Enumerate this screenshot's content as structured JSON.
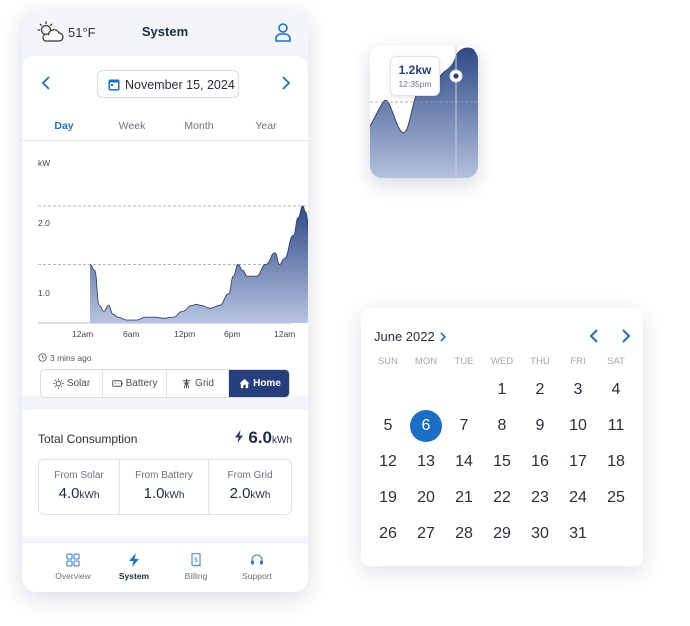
{
  "colors": {
    "accent": "#1a73c8",
    "navy": "#263f7c",
    "chart_fill_top": "#2e4a87",
    "chart_fill_bottom": "#b8c4e0",
    "selected_day": "#1a6fc4"
  },
  "header": {
    "weather_icon": "partly-cloudy-icon",
    "temperature": "51°F",
    "title": "System",
    "profile_icon": "user-icon"
  },
  "date_nav": {
    "date": "November 15, 2024"
  },
  "period_tabs": [
    {
      "label": "Day",
      "active": true
    },
    {
      "label": "Week",
      "active": false
    },
    {
      "label": "Month",
      "active": false
    },
    {
      "label": "Year",
      "active": false
    }
  ],
  "chart_data": {
    "type": "area",
    "ylabel": "kW",
    "y_ticks": [
      "2.0",
      "1.0"
    ],
    "x_ticks": [
      "12am",
      "6am",
      "12pm",
      "6pm",
      "12am"
    ],
    "ylim": [
      0,
      2.0
    ],
    "reference_lines": [
      1.0,
      2.0
    ],
    "series": [
      {
        "x_hours": [
          0,
          0.5,
          1,
          1.5,
          2,
          2.5,
          3,
          4,
          5,
          6,
          7,
          8,
          9,
          10,
          11,
          11.5,
          12,
          13,
          14,
          15,
          15.5,
          16,
          16.5,
          17,
          18,
          19,
          20,
          20.5,
          21,
          22,
          22.5,
          23,
          23.3,
          24
        ],
        "values": [
          1.0,
          0.9,
          0.3,
          0.2,
          0.3,
          0.15,
          0.1,
          0.05,
          0.05,
          0.1,
          0.1,
          0.08,
          0.1,
          0.2,
          0.3,
          0.32,
          0.3,
          0.25,
          0.3,
          0.5,
          0.8,
          1.0,
          0.9,
          0.8,
          0.8,
          1.0,
          1.2,
          1.0,
          1.1,
          1.5,
          1.8,
          2.0,
          1.9,
          1.0
        ]
      }
    ]
  },
  "last_updated": "3 mins ago",
  "sources": [
    {
      "label": "Solar",
      "icon": "solar-panel-icon",
      "active": false
    },
    {
      "label": "Battery",
      "icon": "battery-icon",
      "active": false
    },
    {
      "label": "Grid",
      "icon": "power-tower-icon",
      "active": false
    },
    {
      "label": "Home",
      "icon": "home-icon",
      "active": true
    }
  ],
  "consumption": {
    "title": "Total Consumption",
    "total_value": "6.0",
    "total_unit": "kWh",
    "breakdown": [
      {
        "label": "From Solar",
        "value": "4.0",
        "unit": "kWh"
      },
      {
        "label": "From Battery",
        "value": "1.0",
        "unit": "kWh"
      },
      {
        "label": "From Grid",
        "value": "2.0",
        "unit": "kWh"
      }
    ]
  },
  "bottom_nav": [
    {
      "label": "Overview",
      "icon": "grid-icon",
      "active": false
    },
    {
      "label": "System",
      "icon": "bolt-icon",
      "active": true
    },
    {
      "label": "Billing",
      "icon": "bill-icon",
      "active": false
    },
    {
      "label": "Support",
      "icon": "headset-icon",
      "active": false
    }
  ],
  "tooltip": {
    "value": "1.2kw",
    "time": "12:35pm"
  },
  "calendar": {
    "month_label": "June 2022",
    "weekdays": [
      "SUN",
      "MON",
      "TUE",
      "WED",
      "THU",
      "FRI",
      "SAT"
    ],
    "first_weekday": 3,
    "days_in_month": 30,
    "extra_days": [
      31
    ],
    "selected_day": 6
  }
}
